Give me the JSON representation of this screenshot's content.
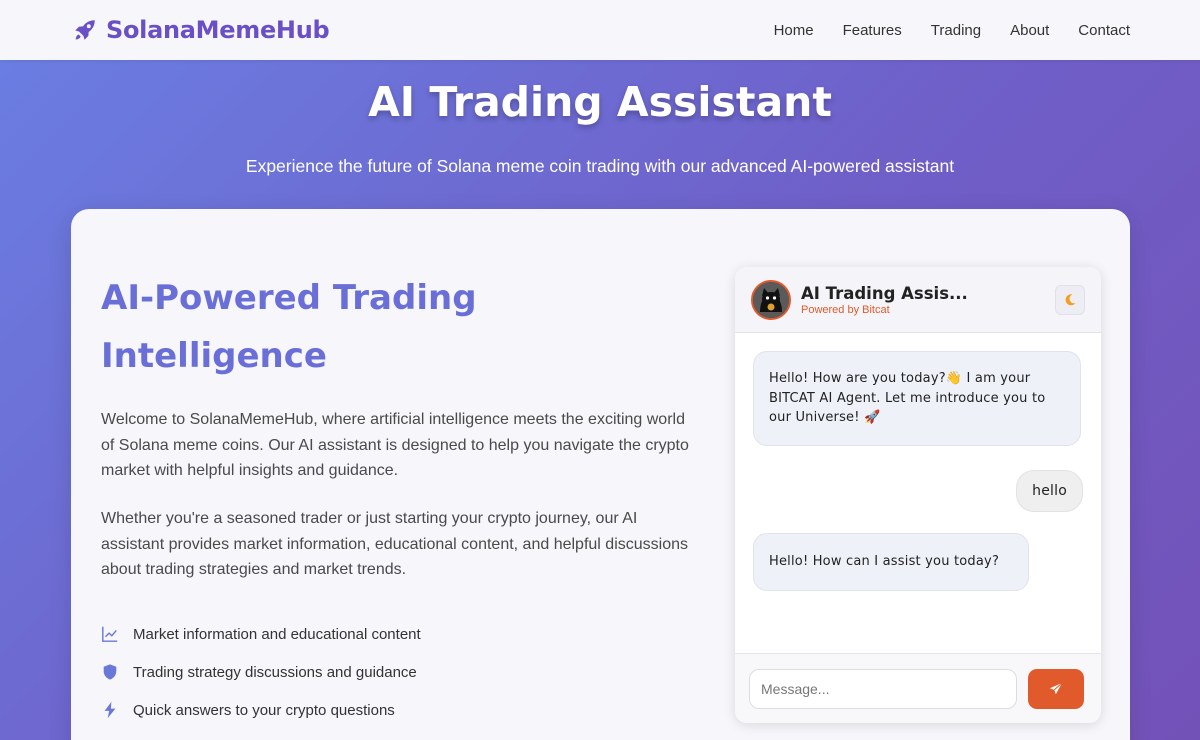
{
  "navbar": {
    "brand": "SolanaMemeHub",
    "brand_icon": "rocket-icon",
    "links": [
      "Home",
      "Features",
      "Trading",
      "About",
      "Contact"
    ]
  },
  "hero": {
    "title": "AI Trading Assistant",
    "subtitle": "Experience the future of Solana meme coin trading with our advanced AI-powered assistant"
  },
  "section": {
    "title": "AI-Powered Trading Intelligence",
    "paragraphs": [
      "Welcome to SolanaMemeHub, where artificial intelligence meets the exciting world of Solana meme coins. Our AI assistant is designed to help you navigate the crypto market with helpful insights and guidance.",
      "Whether you're a seasoned trader or just starting your crypto journey, our AI assistant provides market information, educational content, and helpful discussions about trading strategies and market trends."
    ],
    "features": [
      {
        "icon": "chart-line-icon",
        "label": "Market information and educational content"
      },
      {
        "icon": "shield-icon",
        "label": "Trading strategy discussions and guidance"
      },
      {
        "icon": "bolt-icon",
        "label": "Quick answers to your crypto questions"
      }
    ]
  },
  "chat": {
    "title": "AI Trading Assis...",
    "subtitle": "Powered by Bitcat",
    "theme_icon": "moon-icon",
    "messages": [
      {
        "role": "bot",
        "text": "Hello! How are you today?👋 I am your BITCAT AI Agent. Let me introduce you to our Universe! 🚀"
      },
      {
        "role": "user",
        "text": "hello"
      },
      {
        "role": "bot",
        "text": "Hello! How can I assist you today?"
      }
    ],
    "input_placeholder": "Message...",
    "send_icon": "send-icon"
  },
  "colors": {
    "brand": "#6a4fc6",
    "accent": "#e05a2b",
    "heading": "#6a6fd8",
    "hero_gradient_start": "#6a7fe3",
    "hero_gradient_end": "#7352b8"
  }
}
